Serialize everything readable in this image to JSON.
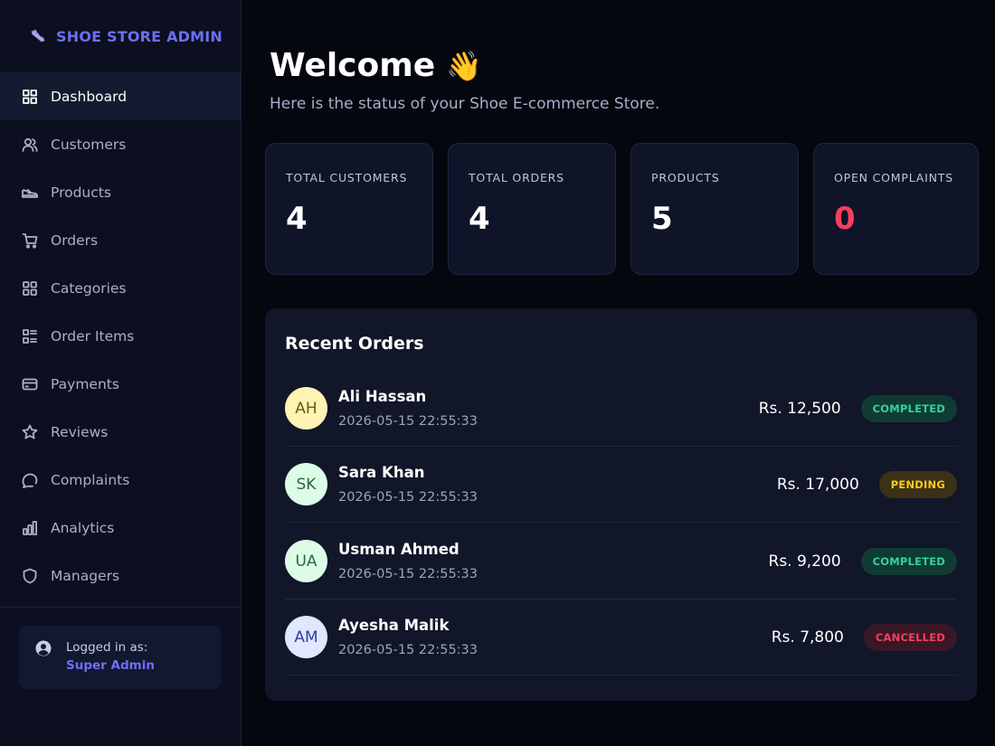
{
  "brand": {
    "title": "SHOE STORE ADMIN",
    "icon": "shoe-icon",
    "color": "#6d6ff2"
  },
  "sidebar": {
    "items": [
      {
        "label": "Dashboard",
        "icon": "dashboard-grid-icon",
        "active": true
      },
      {
        "label": "Customers",
        "icon": "users-icon"
      },
      {
        "label": "Products",
        "icon": "shoe-icon"
      },
      {
        "label": "Orders",
        "icon": "cart-icon"
      },
      {
        "label": "Categories",
        "icon": "grid-icon"
      },
      {
        "label": "Order Items",
        "icon": "list-icon"
      },
      {
        "label": "Payments",
        "icon": "credit-card-icon"
      },
      {
        "label": "Reviews",
        "icon": "star-icon"
      },
      {
        "label": "Complaints",
        "icon": "chat-icon"
      },
      {
        "label": "Analytics",
        "icon": "bar-chart-icon"
      },
      {
        "label": "Managers",
        "icon": "shield-icon"
      }
    ],
    "user": {
      "caption": "Logged in as:",
      "name": "Super Admin"
    }
  },
  "header": {
    "title": "Welcome",
    "emoji": "👋",
    "subtitle": "Here is the status of your Shoe E-commerce Store."
  },
  "stats": [
    {
      "label": "TOTAL CUSTOMERS",
      "value": "4"
    },
    {
      "label": "TOTAL ORDERS",
      "value": "4"
    },
    {
      "label": "PRODUCTS",
      "value": "5"
    },
    {
      "label": "OPEN COMPLAINTS",
      "value": "0",
      "color": "#f43f5e"
    }
  ],
  "recent_orders": {
    "title": "Recent Orders",
    "rows": [
      {
        "initials": "AH",
        "name": "Ali Hassan",
        "date": "2026-05-15 22:55:33",
        "amount": "Rs. 12,500",
        "status": "COMPLETED",
        "avatar_bg": "#fef3b2",
        "avatar_fg": "#6b5a1a"
      },
      {
        "initials": "SK",
        "name": "Sara Khan",
        "date": "2026-05-15 22:55:33",
        "amount": "Rs. 17,000",
        "status": "PENDING",
        "avatar_bg": "#dcfce7",
        "avatar_fg": "#2a6a3e"
      },
      {
        "initials": "UA",
        "name": "Usman Ahmed",
        "date": "2026-05-15 22:55:33",
        "amount": "Rs. 9,200",
        "status": "COMPLETED",
        "avatar_bg": "#dcfce7",
        "avatar_fg": "#2a6a3e"
      },
      {
        "initials": "AM",
        "name": "Ayesha Malik",
        "date": "2026-05-15 22:55:33",
        "amount": "Rs. 7,800",
        "status": "CANCELLED",
        "avatar_bg": "#e0e7ff",
        "avatar_fg": "#33409a"
      }
    ]
  },
  "status_colors": {
    "COMPLETED": {
      "bg": "#0f3b34",
      "fg": "#34d399"
    },
    "PENDING": {
      "bg": "#3a3116",
      "fg": "#facc15"
    },
    "CANCELLED": {
      "bg": "#3a1726",
      "fg": "#f43f5e"
    }
  }
}
